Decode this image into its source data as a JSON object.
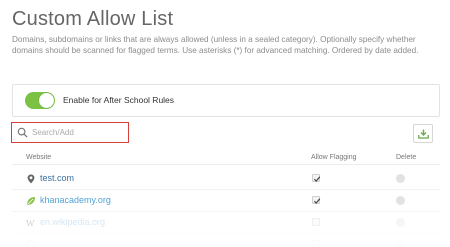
{
  "page": {
    "title": "Custom Allow List",
    "description": "Domains, subdomains or links that are always allowed (unless in a sealed category). Optionally specify whether domains should be scanned for flagged terms. Use asterisks (*) for advanced matching. Ordered by date added."
  },
  "toggle": {
    "label": "Enable for After School Rules",
    "state": "on",
    "color": "#7cc242"
  },
  "search": {
    "placeholder": "Search/Add",
    "value": "",
    "highlight_color": "#d9403a"
  },
  "toolbar": {
    "download_icon": "download-icon"
  },
  "table": {
    "columns": [
      "Website",
      "Allow Flagging",
      "Delete"
    ],
    "rows": [
      {
        "site": "test.com",
        "icon": "location-pin-icon",
        "allow_flagging": true
      },
      {
        "site": "khanacademy.org",
        "icon": "leaf-icon",
        "allow_flagging": true
      },
      {
        "site": "en.wikipedia.org",
        "icon": "wikipedia-icon",
        "allow_flagging": false
      },
      {
        "site": "",
        "icon": "globe-icon",
        "allow_flagging": false
      }
    ]
  }
}
